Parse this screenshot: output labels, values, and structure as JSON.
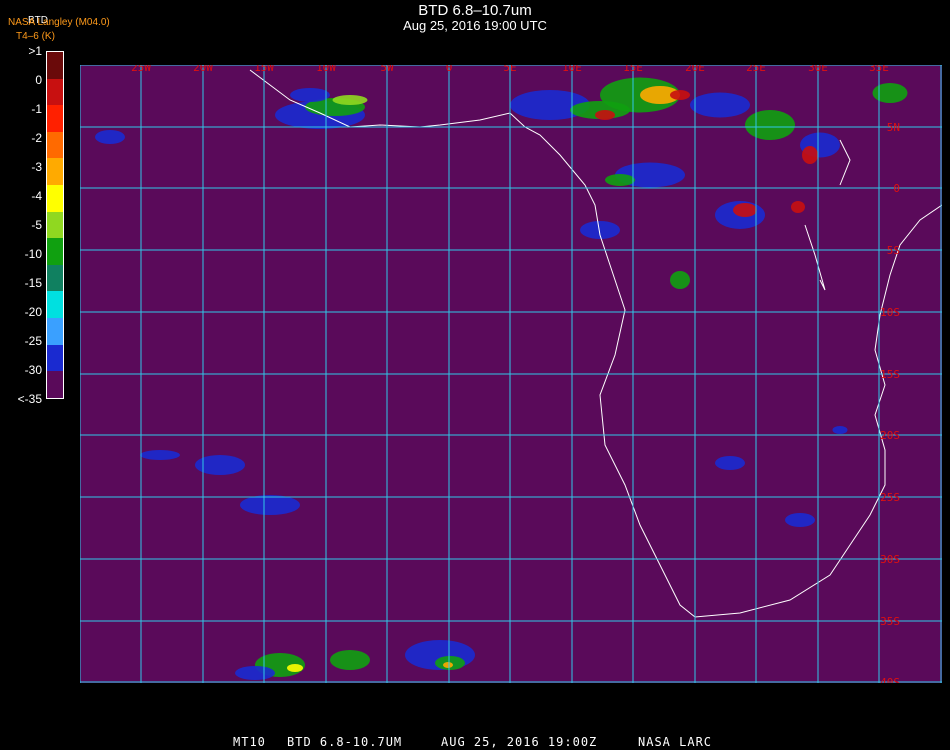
{
  "header": {
    "title": "BTD 6.8–10.7um",
    "subtitle": "Aug 25, 2016 19:00 UTC",
    "org": "NASA Langley (M04.0)",
    "colorbar_title": "T4–6 (K)",
    "colorbar_top": "BTD"
  },
  "colorbar": {
    "labels": [
      ">1",
      "0",
      "-1",
      "-2",
      "-3",
      "-4",
      "-5",
      "-10",
      "-15",
      "-20",
      "-25",
      "-30",
      "<-35"
    ],
    "colors": [
      "#6a0a0a",
      "#c81010",
      "#ff2000",
      "#ff6a00",
      "#ffaa00",
      "#ffff00",
      "#90d820",
      "#10a010",
      "#108060",
      "#00e0e0",
      "#3aa0ff",
      "#1a2ad0",
      "#5a0a5a"
    ]
  },
  "map": {
    "lon_labels": [
      "25W",
      "20W",
      "15W",
      "10W",
      "5W",
      "0",
      "5E",
      "10E",
      "15E",
      "20E",
      "25E",
      "30E",
      "35E"
    ],
    "lat_labels": [
      "5N",
      "0",
      "5S",
      "10S",
      "15S",
      "20S",
      "25S",
      "30S",
      "35S",
      "40S"
    ],
    "grid_color": "#30c8e8",
    "label_color": "#e01010",
    "background_color": "#5a0a5a"
  },
  "footer": {
    "sat": "MT10",
    "product": "BTD 6.8-10.7UM",
    "datetime": "AUG 25, 2016 19:00Z",
    "source": "NASA LARC"
  }
}
